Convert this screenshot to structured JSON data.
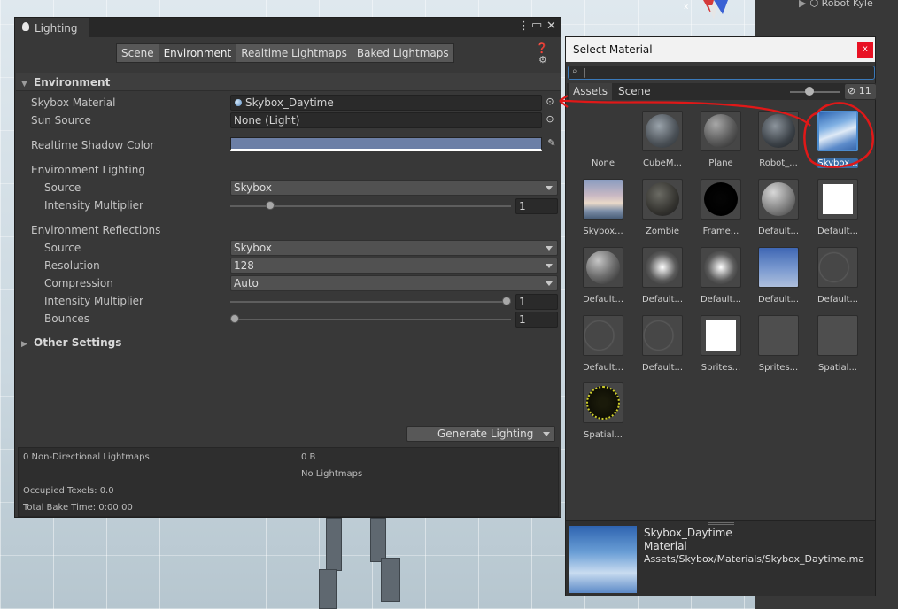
{
  "hierarchy": {
    "item": "Robot Kyle"
  },
  "lighting": {
    "tab_title": "Lighting",
    "tabs": [
      "Scene",
      "Environment",
      "Realtime Lightmaps",
      "Baked Lightmaps"
    ],
    "active_tab": "Environment",
    "environment": {
      "header": "Environment",
      "skybox_label": "Skybox Material",
      "skybox_value": "Skybox_Daytime",
      "sun_label": "Sun Source",
      "sun_value": "None (Light)",
      "shadow_label": "Realtime Shadow Color",
      "shadow_color": "#6c7fa6",
      "env_lighting_label": "Environment Lighting",
      "lighting_source_label": "Source",
      "lighting_source_value": "Skybox",
      "lighting_intensity_label": "Intensity Multiplier",
      "lighting_intensity_value": "1",
      "lighting_intensity_fraction": 0.13,
      "env_reflections_label": "Environment Reflections",
      "refl_source_label": "Source",
      "refl_source_value": "Skybox",
      "resolution_label": "Resolution",
      "resolution_value": "128",
      "compression_label": "Compression",
      "compression_value": "Auto",
      "refl_intensity_label": "Intensity Multiplier",
      "refl_intensity_value": "1",
      "refl_intensity_fraction": 1.0,
      "bounces_label": "Bounces",
      "bounces_value": "1",
      "bounces_fraction": 0.0
    },
    "other_settings": "Other Settings",
    "generate_label": "Generate Lighting",
    "stats": {
      "lightmaps": "0 Non-Directional Lightmaps",
      "size": "0 B",
      "no_lightmaps": "No Lightmaps",
      "texels": "Occupied Texels: 0.0",
      "bake_time": "Total Bake Time: 0:00:00"
    }
  },
  "select_material": {
    "title": "Select Material",
    "close": "x",
    "search_value": "",
    "tabs": [
      "Assets",
      "Scene"
    ],
    "hidden_count": "11",
    "items": [
      {
        "label": "None"
      },
      {
        "label": "CubeM..."
      },
      {
        "label": "Plane"
      },
      {
        "label": "Robot_..."
      },
      {
        "label": "Skybox..."
      },
      {
        "label": "Skybox..."
      },
      {
        "label": "Zombie"
      },
      {
        "label": "Frame..."
      },
      {
        "label": "Default..."
      },
      {
        "label": "Default..."
      },
      {
        "label": "Default..."
      },
      {
        "label": "Default..."
      },
      {
        "label": "Default..."
      },
      {
        "label": "Default..."
      },
      {
        "label": "Default..."
      },
      {
        "label": "Default..."
      },
      {
        "label": "Default..."
      },
      {
        "label": "Sprites..."
      },
      {
        "label": "Sprites..."
      },
      {
        "label": "Spatial..."
      },
      {
        "label": "Spatial..."
      }
    ],
    "preview": {
      "name": "Skybox_Daytime",
      "type": "Material",
      "path": "Assets/Skybox/Materials/Skybox_Daytime.ma"
    }
  }
}
